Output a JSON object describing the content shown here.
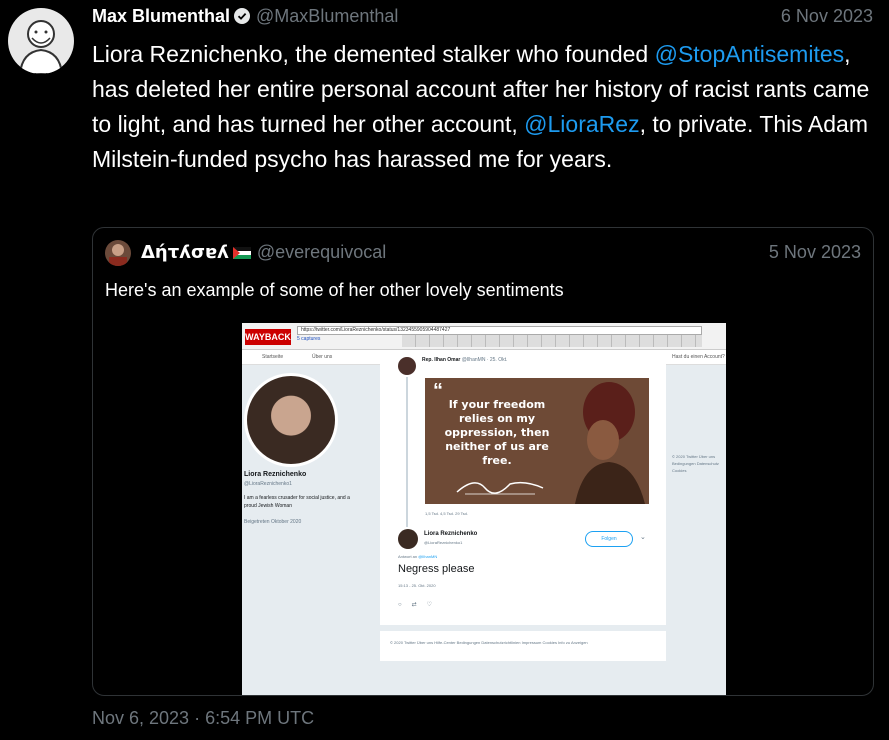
{
  "main": {
    "author": "Max Blumenthal",
    "handle": "@MaxBlumenthal",
    "date": "6 Nov 2023",
    "text": [
      {
        "t": "Liora Reznichenko, the demented stalker who founded ",
        "link": false
      },
      {
        "t": "@StopAntisemites",
        "link": true
      },
      {
        "t": ", has deleted her entire personal account after her history of racist rants came to light, and has turned her other account, ",
        "link": false
      },
      {
        "t": "@LioraRez",
        "link": true
      },
      {
        "t": ", to private. This Adam Milstein-funded psycho has harassed me for years.",
        "link": false
      }
    ],
    "timestamp": "Nov 6, 2023 · 6:54 PM UTC"
  },
  "quote": {
    "author": "Δήτʎσɐʎ",
    "handle": "@everequivocal",
    "date": "5 Nov 2023",
    "text": "Here's an example of some of her other lovely sentiments"
  },
  "screenshot": {
    "wayback_logo": "INTERNET ARCHIVE",
    "url": "https://twitter.com/LioraReznichenko/status/1323455905904487427",
    "captures": "5 captures",
    "nav_items": [
      "Startseite",
      "Über uns"
    ],
    "search_hint": "Hast du einen Account?",
    "profile_name": "Liora Reznichenko",
    "profile_handle": "@LioraReznichenko1",
    "profile_bio": "I am a fearless crusader for social justice, and a proud Jewish Woman",
    "profile_joined": "Beigetreten Oktober 2020",
    "orig_author": "Rep. Ilhan Omar",
    "orig_meta": "@IlhanMN · 25. Okt.",
    "image_quote": "If your freedom relies on my oppression, then neither of us are free.",
    "orig_actions": "1,5 Tsd.   4,5 Tsd.   29 Tsd.",
    "reply_author": "Liora Reznichenko",
    "reply_handle": "@LioraReznichenko1",
    "follow": "Folgen",
    "reply_to_label": "Antwort an",
    "reply_to": "@IlhanMN",
    "reply_text": "Negress please",
    "reply_time": "15:13 - 25. Okt. 2020",
    "footer": "© 2020 Twitter   Über uns   Hilfe-Center   Bedingungen   Datenschutzrichtlinien   Impressum   Cookies   Info zu Anzeigen",
    "side_footer": "© 2020 Twitter  Über uns  Bedingungen  Datenschutz  Cookies"
  },
  "colors": {
    "link": "#1d9bf0",
    "muted": "#6e767d",
    "bg": "#000000",
    "verified": "#1d9bf0"
  }
}
